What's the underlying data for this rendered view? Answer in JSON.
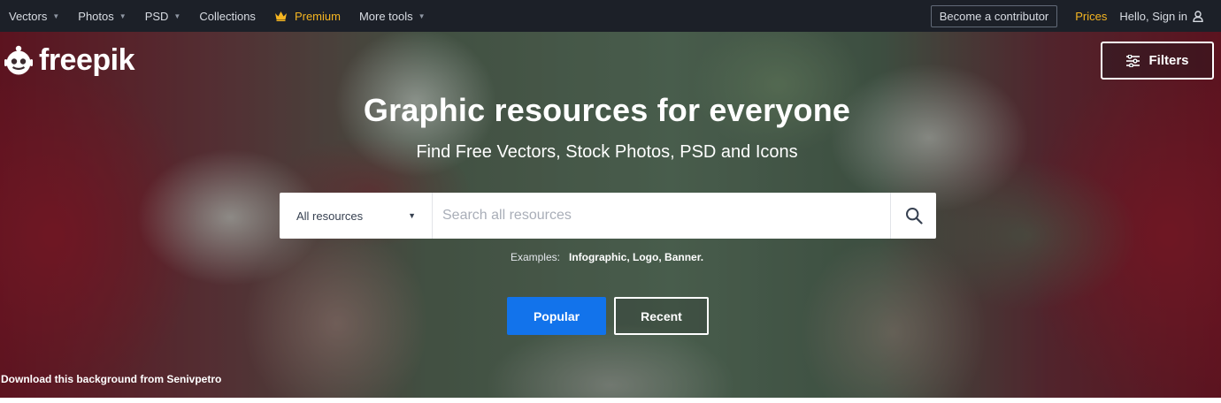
{
  "topnav": {
    "items": [
      {
        "label": "Vectors",
        "dropdown": true
      },
      {
        "label": "Photos",
        "dropdown": true
      },
      {
        "label": "PSD",
        "dropdown": true
      },
      {
        "label": "Collections",
        "dropdown": false
      },
      {
        "label": "Premium",
        "icon": "crown-icon"
      },
      {
        "label": "More tools",
        "dropdown": true
      }
    ],
    "contributor_label": "Become a contributor",
    "prices_label": "Prices",
    "signin_label": "Hello, Sign in",
    "signin_icon": "user-icon"
  },
  "brand": {
    "logo_text": "freepik"
  },
  "filters": {
    "label": "Filters",
    "icon": "sliders-icon"
  },
  "hero": {
    "title": "Graphic resources for everyone",
    "subtitle": "Find Free Vectors, Stock Photos, PSD and Icons"
  },
  "search": {
    "resource_type": "All resources",
    "placeholder": "Search all resources",
    "button_icon": "search-icon"
  },
  "examples": {
    "label": "Examples:",
    "links": [
      "Infographic",
      "Logo",
      "Banner"
    ]
  },
  "tabs": {
    "popular": "Popular",
    "recent": "Recent"
  },
  "credit": "Download this background from Senivpetro",
  "colors": {
    "nav_bg": "#1c2028",
    "premium": "#f5b521",
    "primary": "#1273eb",
    "white": "#ffffff"
  }
}
